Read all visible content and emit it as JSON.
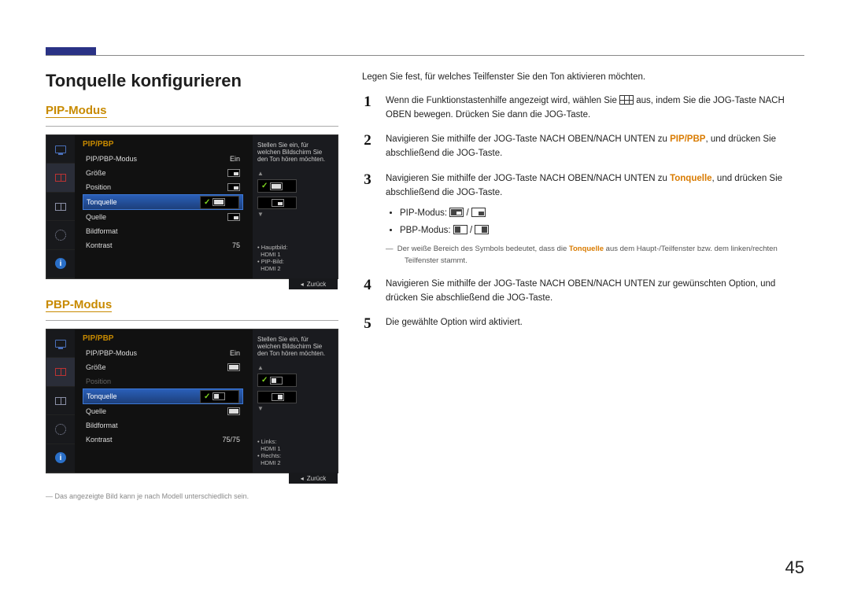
{
  "page_number": "45",
  "heading": "Tonquelle konfigurieren",
  "sections": {
    "pip": {
      "title": "PIP-Modus"
    },
    "pbp": {
      "title": "PBP-Modus"
    }
  },
  "menu": {
    "title": "PIP/PBP",
    "items": {
      "mode": {
        "label": "PIP/PBP-Modus",
        "value": "Ein"
      },
      "size": {
        "label": "Größe"
      },
      "position": {
        "label": "Position"
      },
      "sound": {
        "label": "Tonquelle"
      },
      "source": {
        "label": "Quelle"
      },
      "format": {
        "label": "Bildformat"
      },
      "contrast": {
        "label": "Kontrast",
        "value_pip": "75",
        "value_pbp": "75/75"
      }
    },
    "info_text": "Stellen Sie ein, für welchen Bildschirm Sie den Ton hören möchten.",
    "info_pip": {
      "a": "Hauptbild:",
      "a2": "HDMI 1",
      "b": "PIP-Bild:",
      "b2": "HDMI 2"
    },
    "info_pbp": {
      "a": "Links:",
      "a2": "HDMI 1",
      "b": "Rechts:",
      "b2": "HDMI 2"
    },
    "back": "Zurück"
  },
  "footnote_left": "Das angezeigte Bild kann je nach Modell unterschiedlich sein.",
  "intro": "Legen Sie fest, für welches Teilfenster Sie den Ton aktivieren möchten.",
  "steps": {
    "s1a": "Wenn die Funktionstastenhilfe angezeigt wird, wählen Sie ",
    "s1b": " aus, indem Sie die JOG-Taste NACH OBEN bewegen. Drücken Sie dann die JOG-Taste.",
    "s2a": "Navigieren Sie mithilfe der JOG-Taste NACH OBEN/NACH UNTEN zu ",
    "s2m": "PIP/PBP",
    "s2b": ", und drücken Sie abschließend die JOG-Taste.",
    "s3a": "Navigieren Sie mithilfe der JOG-Taste NACH OBEN/NACH UNTEN zu ",
    "s3m": "Tonquelle",
    "s3b": ", und drücken Sie abschließend die JOG-Taste.",
    "b_pip": "PIP-Modus: ",
    "b_pbp": "PBP-Modus: ",
    "note_a": "Der weiße Bereich des Symbols bedeutet, dass die ",
    "note_m": "Tonquelle",
    "note_b": " aus dem Haupt-/Teilfenster bzw. dem linken/rechten Teilfenster stammt.",
    "s4": "Navigieren Sie mithilfe der JOG-Taste NACH OBEN/NACH UNTEN zur gewünschten Option, und drücken Sie abschließend die JOG-Taste.",
    "s5": "Die gewählte Option wird aktiviert."
  }
}
